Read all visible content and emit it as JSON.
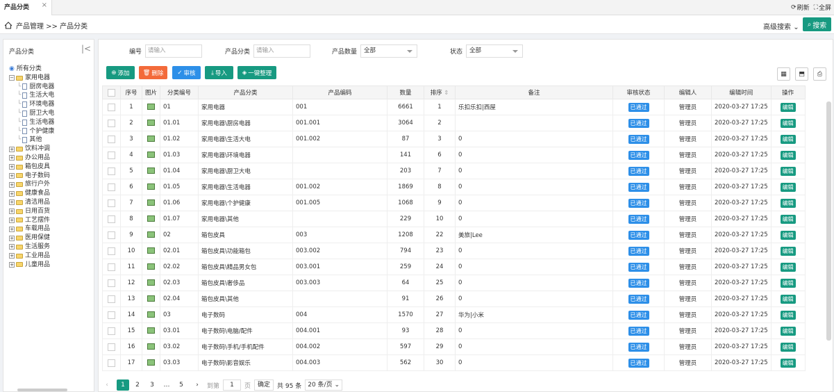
{
  "tab": {
    "label": "产品分类",
    "close": "×"
  },
  "top_actions": {
    "refresh": "刷新",
    "fullscreen": "全屏"
  },
  "breadcrumb": "产品管理 >> 产品分类",
  "advanced_search": "高级搜索",
  "search_button": "搜索",
  "sidebar": {
    "title": "产品分类"
  },
  "tree": [
    {
      "label": "所有分类",
      "level": 0,
      "type": "root"
    },
    {
      "label": "家用电器",
      "level": 0,
      "type": "open"
    },
    {
      "label": "厨房电器",
      "level": 1,
      "type": "file"
    },
    {
      "label": "生活大电",
      "level": 1,
      "type": "file"
    },
    {
      "label": "环境电器",
      "level": 1,
      "type": "file"
    },
    {
      "label": "厨卫大电",
      "level": 1,
      "type": "file"
    },
    {
      "label": "生活电器",
      "level": 1,
      "type": "file"
    },
    {
      "label": "个护健康",
      "level": 1,
      "type": "file"
    },
    {
      "label": "其他",
      "level": 1,
      "type": "file"
    },
    {
      "label": "饮料冲调",
      "level": 0,
      "type": "closed"
    },
    {
      "label": "办公用品",
      "level": 0,
      "type": "closed"
    },
    {
      "label": "箱包皮具",
      "level": 0,
      "type": "closed"
    },
    {
      "label": "电子数码",
      "level": 0,
      "type": "closed"
    },
    {
      "label": "旅行户外",
      "level": 0,
      "type": "closed"
    },
    {
      "label": "健康食品",
      "level": 0,
      "type": "closed"
    },
    {
      "label": "清洁用品",
      "level": 0,
      "type": "closed"
    },
    {
      "label": "日用百货",
      "level": 0,
      "type": "closed"
    },
    {
      "label": "工艺摆件",
      "level": 0,
      "type": "closed"
    },
    {
      "label": "车载用品",
      "level": 0,
      "type": "closed"
    },
    {
      "label": "医用保健",
      "level": 0,
      "type": "closed"
    },
    {
      "label": "生活服务",
      "level": 0,
      "type": "closed"
    },
    {
      "label": "工业用品",
      "level": 0,
      "type": "closed"
    },
    {
      "label": "儿童用品",
      "level": 0,
      "type": "closed"
    }
  ],
  "filters": {
    "code_label": "编号",
    "code_placeholder": "请输入",
    "category_label": "产品分类",
    "category_placeholder": "请输入",
    "qty_label": "产品数量",
    "qty_value": "全部",
    "status_label": "状态",
    "status_value": "全部"
  },
  "toolbar": {
    "add": "添加",
    "delete": "删除",
    "audit": "审核",
    "import": "导入",
    "organize": "一键整理"
  },
  "table": {
    "headers": [
      "",
      "序号",
      "图片",
      "分类编号",
      "产品分类",
      "产品编码",
      "数量",
      "排序",
      "备注",
      "审核状态",
      "编辑人",
      "编辑时间",
      "操作"
    ],
    "rows": [
      {
        "no": "1",
        "code": "01",
        "cat": "家用电器",
        "pcode": "001",
        "qty": "6661",
        "sort": "1",
        "remark": "乐扣乐扣|西屋"
      },
      {
        "no": "2",
        "code": "01.01",
        "cat": "家用电器\\厨房电器",
        "pcode": "001.001",
        "qty": "3064",
        "sort": "2",
        "remark": ""
      },
      {
        "no": "3",
        "code": "01.02",
        "cat": "家用电器\\生活大电",
        "pcode": "001.002",
        "qty": "87",
        "sort": "3",
        "remark": "0"
      },
      {
        "no": "4",
        "code": "01.03",
        "cat": "家用电器\\环境电器",
        "pcode": "",
        "qty": "141",
        "sort": "6",
        "remark": "0"
      },
      {
        "no": "5",
        "code": "01.04",
        "cat": "家用电器\\厨卫大电",
        "pcode": "",
        "qty": "203",
        "sort": "7",
        "remark": "0"
      },
      {
        "no": "6",
        "code": "01.05",
        "cat": "家用电器\\生活电器",
        "pcode": "001.002",
        "qty": "1869",
        "sort": "8",
        "remark": "0"
      },
      {
        "no": "7",
        "code": "01.06",
        "cat": "家用电器\\个护健康",
        "pcode": "001.005",
        "qty": "1068",
        "sort": "9",
        "remark": "0"
      },
      {
        "no": "8",
        "code": "01.07",
        "cat": "家用电器\\其他",
        "pcode": "",
        "qty": "229",
        "sort": "10",
        "remark": "0"
      },
      {
        "no": "9",
        "code": "02",
        "cat": "箱包皮具",
        "pcode": "003",
        "qty": "1208",
        "sort": "22",
        "remark": "美旅|Lee"
      },
      {
        "no": "10",
        "code": "02.01",
        "cat": "箱包皮具\\功能箱包",
        "pcode": "003.002",
        "qty": "794",
        "sort": "23",
        "remark": "0"
      },
      {
        "no": "11",
        "code": "02.02",
        "cat": "箱包皮具\\精品男女包",
        "pcode": "003.001",
        "qty": "259",
        "sort": "24",
        "remark": "0"
      },
      {
        "no": "12",
        "code": "02.03",
        "cat": "箱包皮具\\奢侈品",
        "pcode": "003.003",
        "qty": "64",
        "sort": "25",
        "remark": "0"
      },
      {
        "no": "13",
        "code": "02.04",
        "cat": "箱包皮具\\其他",
        "pcode": "",
        "qty": "91",
        "sort": "26",
        "remark": "0"
      },
      {
        "no": "14",
        "code": "03",
        "cat": "电子数码",
        "pcode": "004",
        "qty": "1570",
        "sort": "27",
        "remark": "华为|小米"
      },
      {
        "no": "15",
        "code": "03.01",
        "cat": "电子数码\\电脑/配件",
        "pcode": "004.001",
        "qty": "93",
        "sort": "28",
        "remark": "0"
      },
      {
        "no": "16",
        "code": "03.02",
        "cat": "电子数码\\手机/手机配件",
        "pcode": "004.002",
        "qty": "597",
        "sort": "29",
        "remark": "0"
      },
      {
        "no": "17",
        "code": "03.03",
        "cat": "电子数码\\影音娱乐",
        "pcode": "004.003",
        "qty": "562",
        "sort": "30",
        "remark": "0"
      }
    ],
    "status": "已通过",
    "editor": "管理员",
    "time": "2020-03-27 17:25",
    "edit": "编辑"
  },
  "pager": {
    "prev": "‹",
    "pages": [
      "1",
      "2",
      "3",
      "…",
      "5"
    ],
    "next": "›",
    "goto_label": "到第",
    "goto_value": "1",
    "page_unit": "页",
    "confirm": "确定",
    "total": "共 95 条",
    "size": "20 条/页"
  },
  "colors": {
    "primary": "#179a81",
    "danger": "#f36a3a",
    "info": "#2d8fe8"
  }
}
